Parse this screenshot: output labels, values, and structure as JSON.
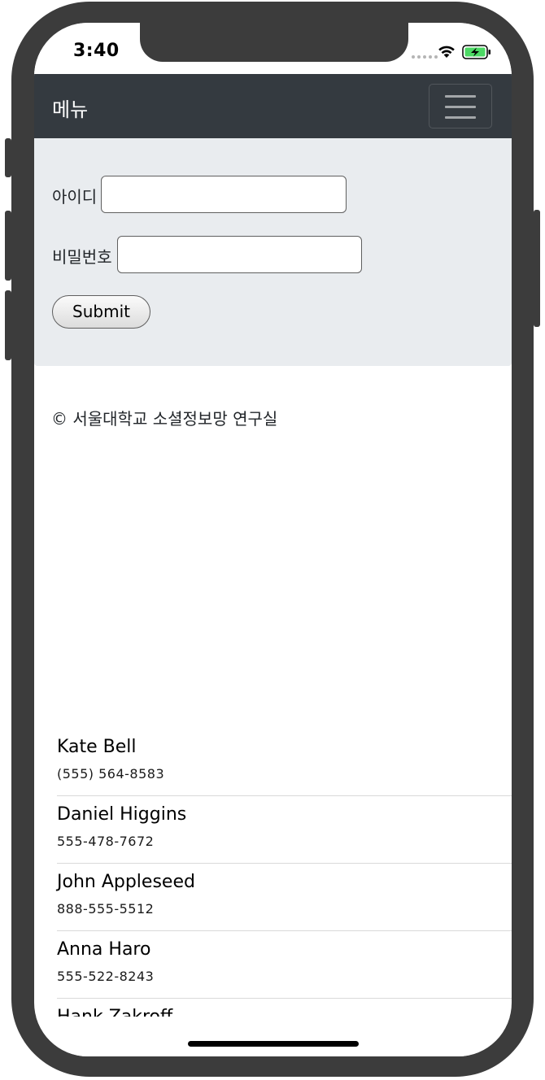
{
  "status_bar": {
    "time": "3:40",
    "wifi_icon": "wifi-icon",
    "battery_icon": "battery-charging-icon",
    "battery_color": "#4cd964"
  },
  "navbar": {
    "brand": "메뉴",
    "toggler_icon": "hamburger-menu-icon",
    "background": "#343a40"
  },
  "login_form": {
    "id_label": "아이디",
    "id_value": "",
    "password_label": "비밀번호",
    "password_value": "",
    "submit_label": "Submit",
    "background": "#e9ecef"
  },
  "footer": {
    "copyright": "© 서울대학교 소셜정보망 연구실"
  },
  "contacts": [
    {
      "name": "Kate Bell",
      "phone": "(555) 564-8583"
    },
    {
      "name": "Daniel Higgins",
      "phone": "555-478-7672"
    },
    {
      "name": "John Appleseed",
      "phone": "888-555-5512"
    },
    {
      "name": "Anna Haro",
      "phone": "555-522-8243"
    },
    {
      "name": "Hank Zakroff",
      "phone": ""
    }
  ]
}
